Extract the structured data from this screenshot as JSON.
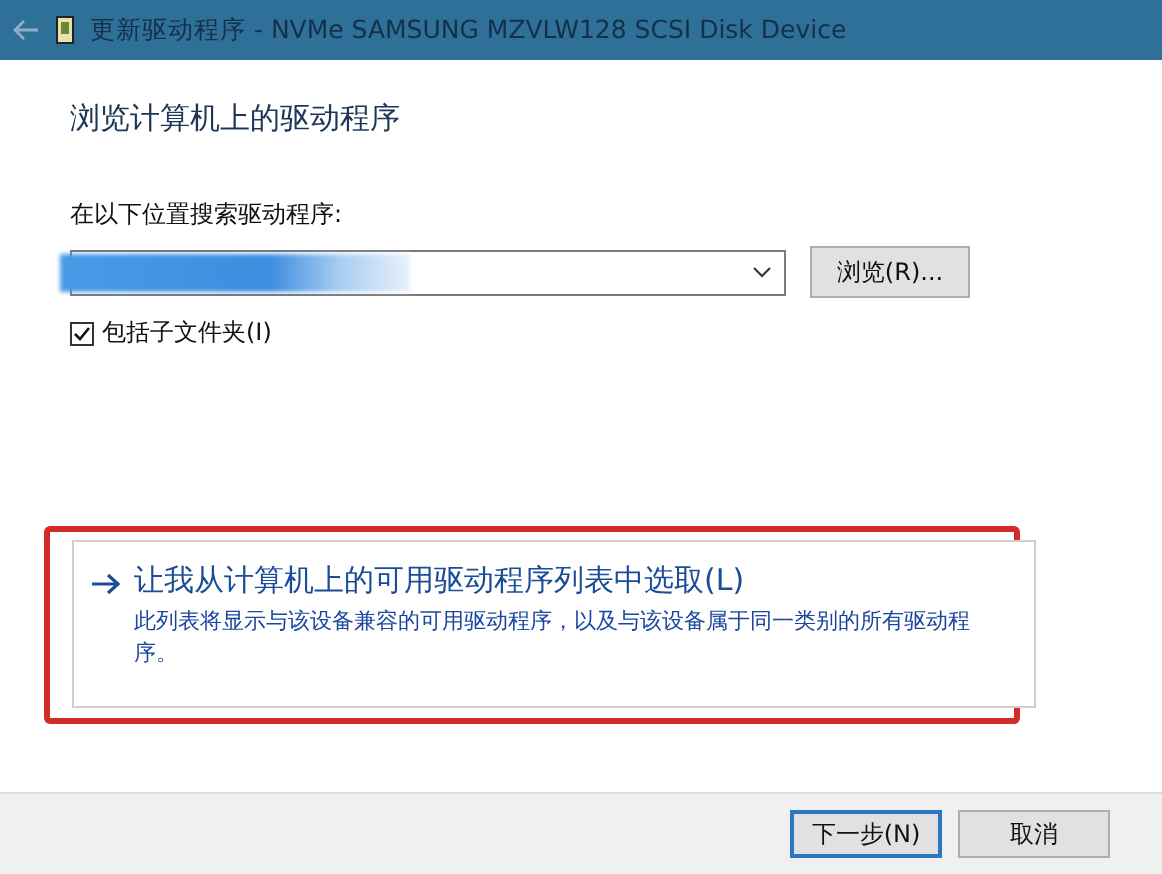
{
  "window": {
    "title": "更新驱动程序 - NVMe SAMSUNG MZVLW128 SCSI Disk Device"
  },
  "heading": "浏览计算机上的驱动程序",
  "search_label": "在以下位置搜索驱动程序:",
  "path_field": {
    "kind": "redacted"
  },
  "browse_button": "浏览(R)...",
  "include_subfolders": {
    "label": "包括子文件夹(I)",
    "checked": true
  },
  "option": {
    "title": "让我从计算机上的可用驱动程序列表中选取(L)",
    "description": "此列表将显示与该设备兼容的可用驱动程序，以及与该设备属于同一类别的所有驱动程序。",
    "highlighted": true
  },
  "buttons": [
    {
      "label": "下一步(N)",
      "default": true
    },
    {
      "label": "取消",
      "default": false
    }
  ]
}
